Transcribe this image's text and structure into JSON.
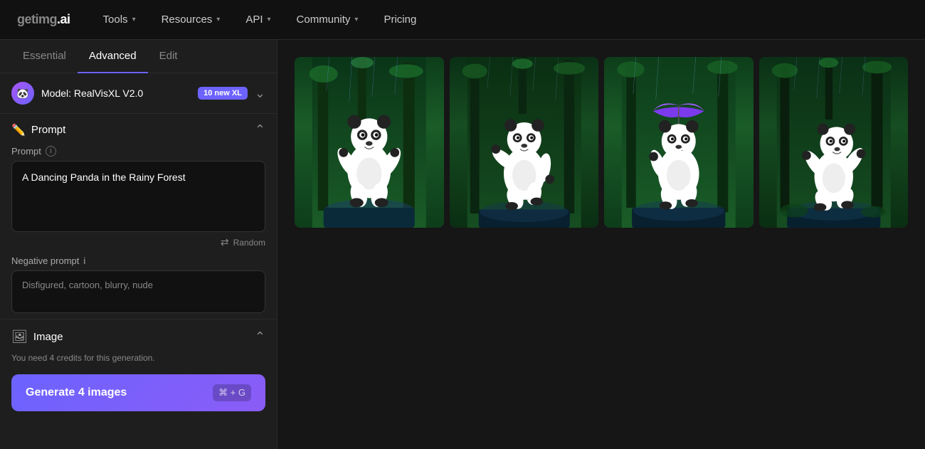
{
  "nav": {
    "logo": "getimg.ai",
    "items": [
      {
        "label": "Tools",
        "has_chevron": true
      },
      {
        "label": "Resources",
        "has_chevron": true
      },
      {
        "label": "API",
        "has_chevron": true
      },
      {
        "label": "Community",
        "has_chevron": true
      },
      {
        "label": "Pricing",
        "has_chevron": false
      }
    ]
  },
  "sidebar": {
    "tabs": [
      {
        "label": "Essential",
        "active": false
      },
      {
        "label": "Advanced",
        "active": true
      },
      {
        "label": "Edit",
        "active": false
      }
    ],
    "model": {
      "label": "Model: RealVisXL V2.0",
      "badge": "10 new XL"
    },
    "prompt_section": {
      "title": "Prompt",
      "field_label": "Prompt",
      "value": "A Dancing Panda in the Rainy Forest",
      "placeholder": "A Dancing Panda in the Rainy Forest",
      "random_label": "Random"
    },
    "negative_prompt": {
      "label": "Negative prompt",
      "value": "Disfigured, cartoon, blurry, nude",
      "placeholder": "Disfigured, cartoon, blurry, nude"
    },
    "image_section": {
      "title": "Image"
    },
    "credits": "You need 4 credits for this generation.",
    "generate_button": {
      "label": "Generate 4 images",
      "shortcut": "⌘ + G"
    }
  },
  "images": [
    {
      "id": 1,
      "alt": "Dancing panda 1"
    },
    {
      "id": 2,
      "alt": "Dancing panda 2"
    },
    {
      "id": 3,
      "alt": "Dancing panda 3"
    },
    {
      "id": 4,
      "alt": "Dancing panda 4"
    }
  ]
}
